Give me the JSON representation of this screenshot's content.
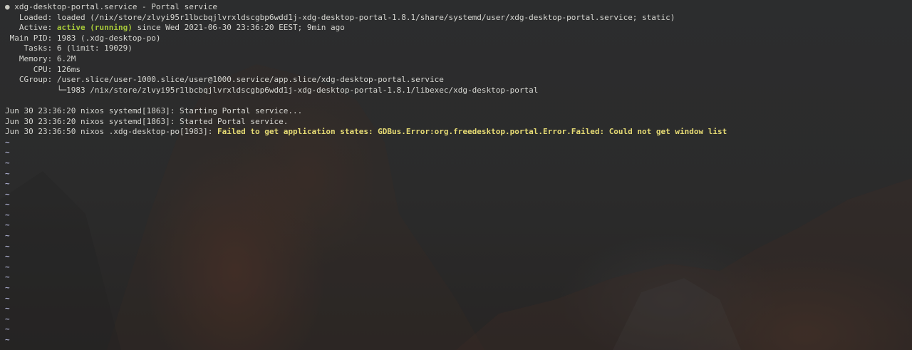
{
  "header": {
    "bullet": "●",
    "title": "xdg-desktop-portal.service - Portal service"
  },
  "status": {
    "loaded_label": "   Loaded: ",
    "loaded_value": "loaded (/nix/store/zlvyi95r1lbcbqjlvrxldscgbp6wdd1j-xdg-desktop-portal-1.8.1/share/systemd/user/xdg-desktop-portal.service; static)",
    "active_label": "   Active: ",
    "active_state": "active (running)",
    "active_since": " since Wed 2021-06-30 23:36:20 EEST; 9min ago",
    "mainpid_label": " Main PID: ",
    "mainpid_value": "1983 (.xdg-desktop-po)",
    "tasks_label": "    Tasks: ",
    "tasks_value": "6 (limit: 19029)",
    "memory_label": "   Memory: ",
    "memory_value": "6.2M",
    "cpu_label": "      CPU: ",
    "cpu_value": "126ms",
    "cgroup_label": "   CGroup: ",
    "cgroup_value": "/user.slice/user-1000.slice/user@1000.service/app.slice/xdg-desktop-portal.service",
    "cgroup_child": "           └─1983 /nix/store/zlvyi95r1lbcbqjlvrxldscgbp6wdd1j-xdg-desktop-portal-1.8.1/libexec/xdg-desktop-portal"
  },
  "log": [
    {
      "prefix": "Jun 30 23:36:20 nixos systemd[1863]: ",
      "message": "Starting Portal service..."
    },
    {
      "prefix": "Jun 30 23:36:20 nixos systemd[1863]: ",
      "message": "Started Portal service."
    },
    {
      "prefix": "Jun 30 23:36:50 nixos .xdg-desktop-po[1983]: ",
      "message": "Failed to get application states: GDBus.Error:org.freedesktop.portal.Error.Failed: Could not get window list"
    }
  ],
  "tilde": "~",
  "colors": {
    "active": "#a6c83a",
    "warning": "#e6db74",
    "tilde": "#a7a9c9",
    "text": "#d7d7d2"
  }
}
